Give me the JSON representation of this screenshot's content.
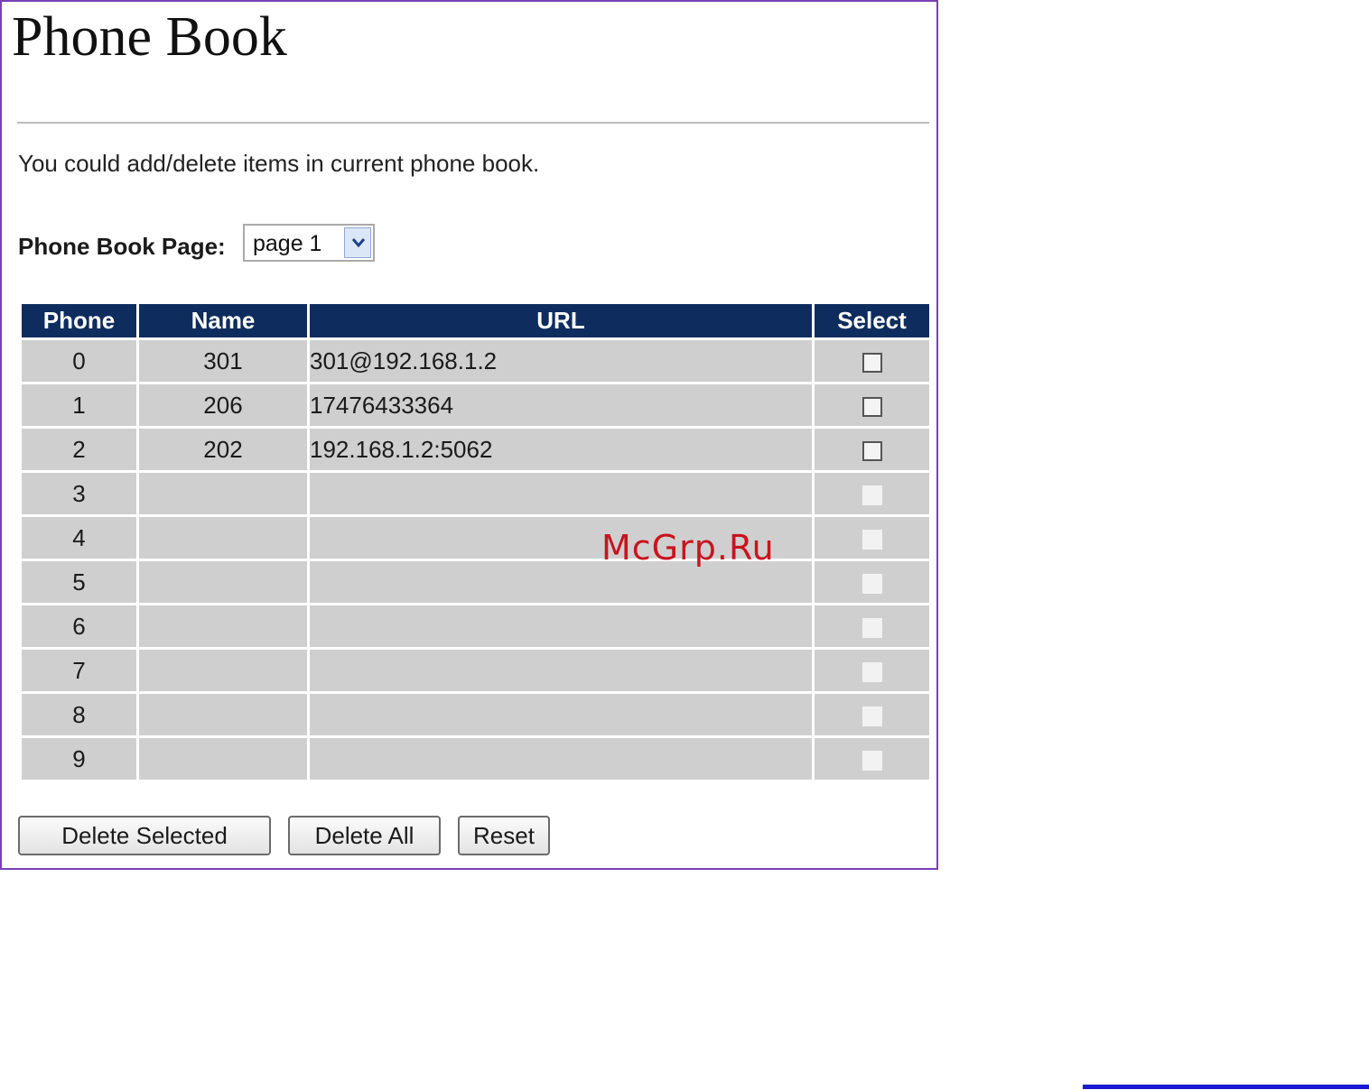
{
  "page": {
    "title": "Phone Book",
    "description": "You could add/delete items in current phone book."
  },
  "page_selector": {
    "label": "Phone Book Page:",
    "selected": "page 1"
  },
  "table": {
    "headers": [
      "Phone",
      "Name",
      "URL",
      "Select"
    ],
    "rows": [
      {
        "phone": "0",
        "name": "301",
        "url": "301@192.168.1.2",
        "select_enabled": true
      },
      {
        "phone": "1",
        "name": "206",
        "url": "17476433364",
        "select_enabled": true
      },
      {
        "phone": "2",
        "name": "202",
        "url": "192.168.1.2:5062",
        "select_enabled": true
      },
      {
        "phone": "3",
        "name": "",
        "url": "",
        "select_enabled": false
      },
      {
        "phone": "4",
        "name": "",
        "url": "",
        "select_enabled": false
      },
      {
        "phone": "5",
        "name": "",
        "url": "",
        "select_enabled": false
      },
      {
        "phone": "6",
        "name": "",
        "url": "",
        "select_enabled": false
      },
      {
        "phone": "7",
        "name": "",
        "url": "",
        "select_enabled": false
      },
      {
        "phone": "8",
        "name": "",
        "url": "",
        "select_enabled": false
      },
      {
        "phone": "9",
        "name": "",
        "url": "",
        "select_enabled": false
      }
    ]
  },
  "buttons": {
    "delete_selected": "Delete Selected",
    "delete_all": "Delete All",
    "reset": "Reset"
  },
  "watermark": "McGrp.Ru",
  "colors": {
    "frame_border": "#7b3fb5",
    "header_bg": "#0e2d5e",
    "cell_bg": "#cfcfcf",
    "watermark": "#c8141e",
    "link_line": "#1a1ad6"
  }
}
